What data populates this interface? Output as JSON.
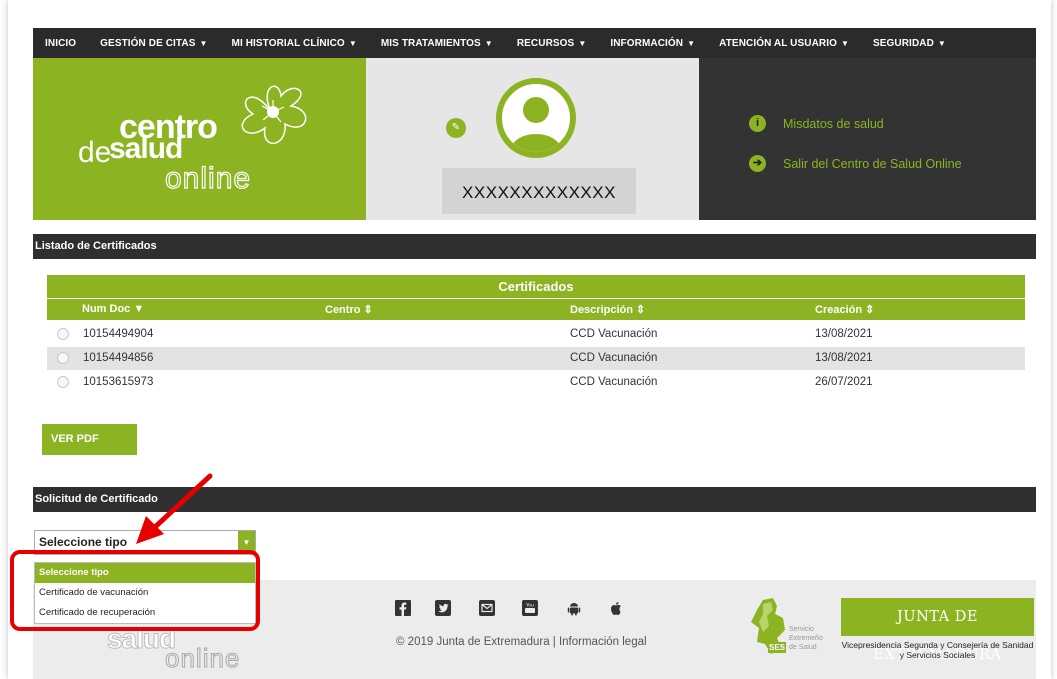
{
  "nav": {
    "items": [
      {
        "label": "INICIO",
        "caret": ""
      },
      {
        "label": "GESTIÓN DE CITAS",
        "caret": "▼"
      },
      {
        "label": "MI HISTORIAL CLÍNICO",
        "caret": "▼"
      },
      {
        "label": "MIS TRATAMIENTOS",
        "caret": "▼"
      },
      {
        "label": "RECURSOS",
        "caret": "▼"
      },
      {
        "label": "INFORMACIÓN",
        "caret": "▼"
      },
      {
        "label": "ATENCIÓN AL USUARIO",
        "caret": "▼"
      },
      {
        "label": "SEGURIDAD",
        "caret": "▼"
      }
    ]
  },
  "logo": {
    "line1": "centro",
    "line2a": "de",
    "line2b": "salud",
    "line3": "online"
  },
  "profile": {
    "username": "XXXXXXXXXXXXX",
    "edit_icon": "edit-icon",
    "avatar_icon": "user-avatar-icon"
  },
  "user_links": {
    "health_prefix": "Mis ",
    "health_label": "datos de salud",
    "logout_label": "Salir del Centro de Salud Online",
    "health_icon": "info-icon",
    "logout_icon": "exit-arrow-icon"
  },
  "certificates_section": {
    "title": "Listado de Certificados"
  },
  "table": {
    "title": "Certificados",
    "columns": [
      "Num Doc ▼",
      "Centro ⇕",
      "Descripción ⇕",
      "Creación ⇕"
    ],
    "rows": [
      {
        "num": "10154494904",
        "centro": "",
        "descripcion": "CCD Vacunación",
        "creacion": "13/08/2021"
      },
      {
        "num": "10154494856",
        "centro": "",
        "descripcion": "CCD Vacunación",
        "creacion": "13/08/2021"
      },
      {
        "num": "10153615973",
        "centro": "",
        "descripcion": "CCD Vacunación",
        "creacion": "26/07/2021"
      }
    ]
  },
  "view_pdf_button": "VER PDF",
  "request_section": {
    "title": "Solicitud de Certificado"
  },
  "type_select": {
    "value": "Seleccione tipo",
    "options": [
      "Seleccione tipo",
      "Certificado de vacunación",
      "Certificado de recuperación"
    ]
  },
  "footer": {
    "copyright": "© 2019 Junta de Extremadura | Información legal",
    "social_icons": [
      "facebook-icon",
      "twitter-icon",
      "email-icon",
      "youtube-icon",
      "android-icon",
      "apple-icon"
    ],
    "ses_text": "Servicio\nExtremeño\nde Salud",
    "ses_label": "SES",
    "junta_title": "JUNTA DE EXTREMADURA",
    "junta_sub": "Vicepresidencia Segunda y Consejería de Sanidad y Servicios Sociales"
  },
  "colors": {
    "brand_green": "#8cb322",
    "dark": "#2b2b2b",
    "annotation_red": "#e60000"
  }
}
